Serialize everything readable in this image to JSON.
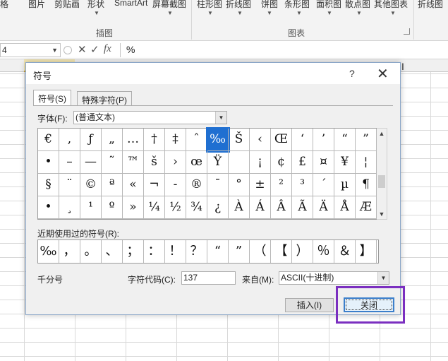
{
  "ribbon": {
    "items": [
      "格",
      "图片",
      "剪贴画",
      "形状",
      "SmartArt",
      "屏幕截图",
      "柱形图",
      "折线图",
      "饼图",
      "条形图",
      "面积图",
      "散点图",
      "其他图表",
      "折线图"
    ],
    "groups": [
      "插图",
      "图表"
    ]
  },
  "formula_bar": {
    "name_box": "4",
    "cancel_icon": "✕",
    "enter_icon": "✓",
    "fx_label": "fx",
    "content": "%"
  },
  "dialog": {
    "title": "符号",
    "help": "?",
    "close": "✕",
    "tabs": [
      "符号(S)",
      "特殊字符(P)"
    ],
    "font_label": "字体(F):",
    "font_value": "(普通文本)",
    "symbols": [
      [
        "€",
        ",",
        "ƒ",
        "„",
        "…",
        "†",
        "‡",
        "ˆ",
        "‰",
        "Š",
        "‹",
        "Œ",
        "‘",
        "’",
        "“",
        "”"
      ],
      [
        "•",
        "–",
        "—",
        "˜",
        "™",
        "š",
        "›",
        "œ",
        "Ÿ",
        "",
        "¡",
        "¢",
        "£",
        "¤",
        "¥",
        "¦"
      ],
      [
        "§",
        "¨",
        "©",
        "ª",
        "«",
        "¬",
        "-",
        "®",
        "¯",
        "°",
        "±",
        "²",
        "³",
        "´",
        "µ",
        "¶"
      ],
      [
        "•",
        "¸",
        "¹",
        "º",
        "»",
        "¼",
        "½",
        "¾",
        "¿",
        "À",
        "Á",
        "Â",
        "Ã",
        "Ä",
        "Å",
        "Æ"
      ]
    ],
    "selected_symbol": "‰",
    "recent_label": "近期使用过的符号(R):",
    "recent_symbols": [
      "‰",
      "，",
      "。",
      "、",
      "；",
      "：",
      "！",
      "？",
      "“",
      "”",
      "（",
      "【",
      "）",
      "％",
      "＆",
      "】"
    ],
    "char_name": "千分号",
    "code_label": "字符代码(C):",
    "code_value": "137",
    "from_label": "来自(M):",
    "from_value": "ASCII(十进制)",
    "insert_button": "插入(I)",
    "close_button": "关闭"
  }
}
